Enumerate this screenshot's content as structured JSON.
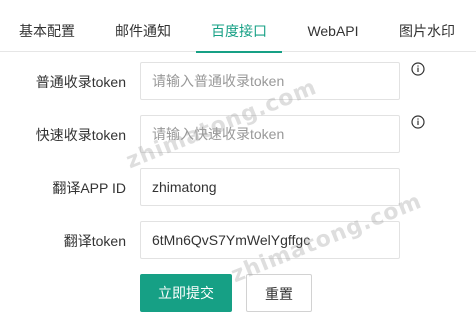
{
  "tabs": [
    {
      "label": "基本配置"
    },
    {
      "label": "邮件通知"
    },
    {
      "label": "百度接口"
    },
    {
      "label": "WebAPI"
    },
    {
      "label": "图片水印"
    }
  ],
  "active_tab": "百度接口",
  "form": {
    "normal_token": {
      "label": "普通收录token",
      "value": "",
      "placeholder": "请输入普通收录token"
    },
    "fast_token": {
      "label": "快速收录token",
      "value": "",
      "placeholder": "请输入快速收录token"
    },
    "app_id": {
      "label": "翻译APP ID",
      "value": "zhimatong",
      "placeholder": ""
    },
    "translate_token": {
      "label": "翻译token",
      "value": "6tMn6QvS7YmWelYgffgc",
      "placeholder": ""
    }
  },
  "buttons": {
    "submit": "立即提交",
    "reset": "重置"
  },
  "watermark": "zhimatong.com",
  "colors": {
    "accent": "#16a085"
  },
  "icons": {
    "help": "info-circle-icon"
  }
}
